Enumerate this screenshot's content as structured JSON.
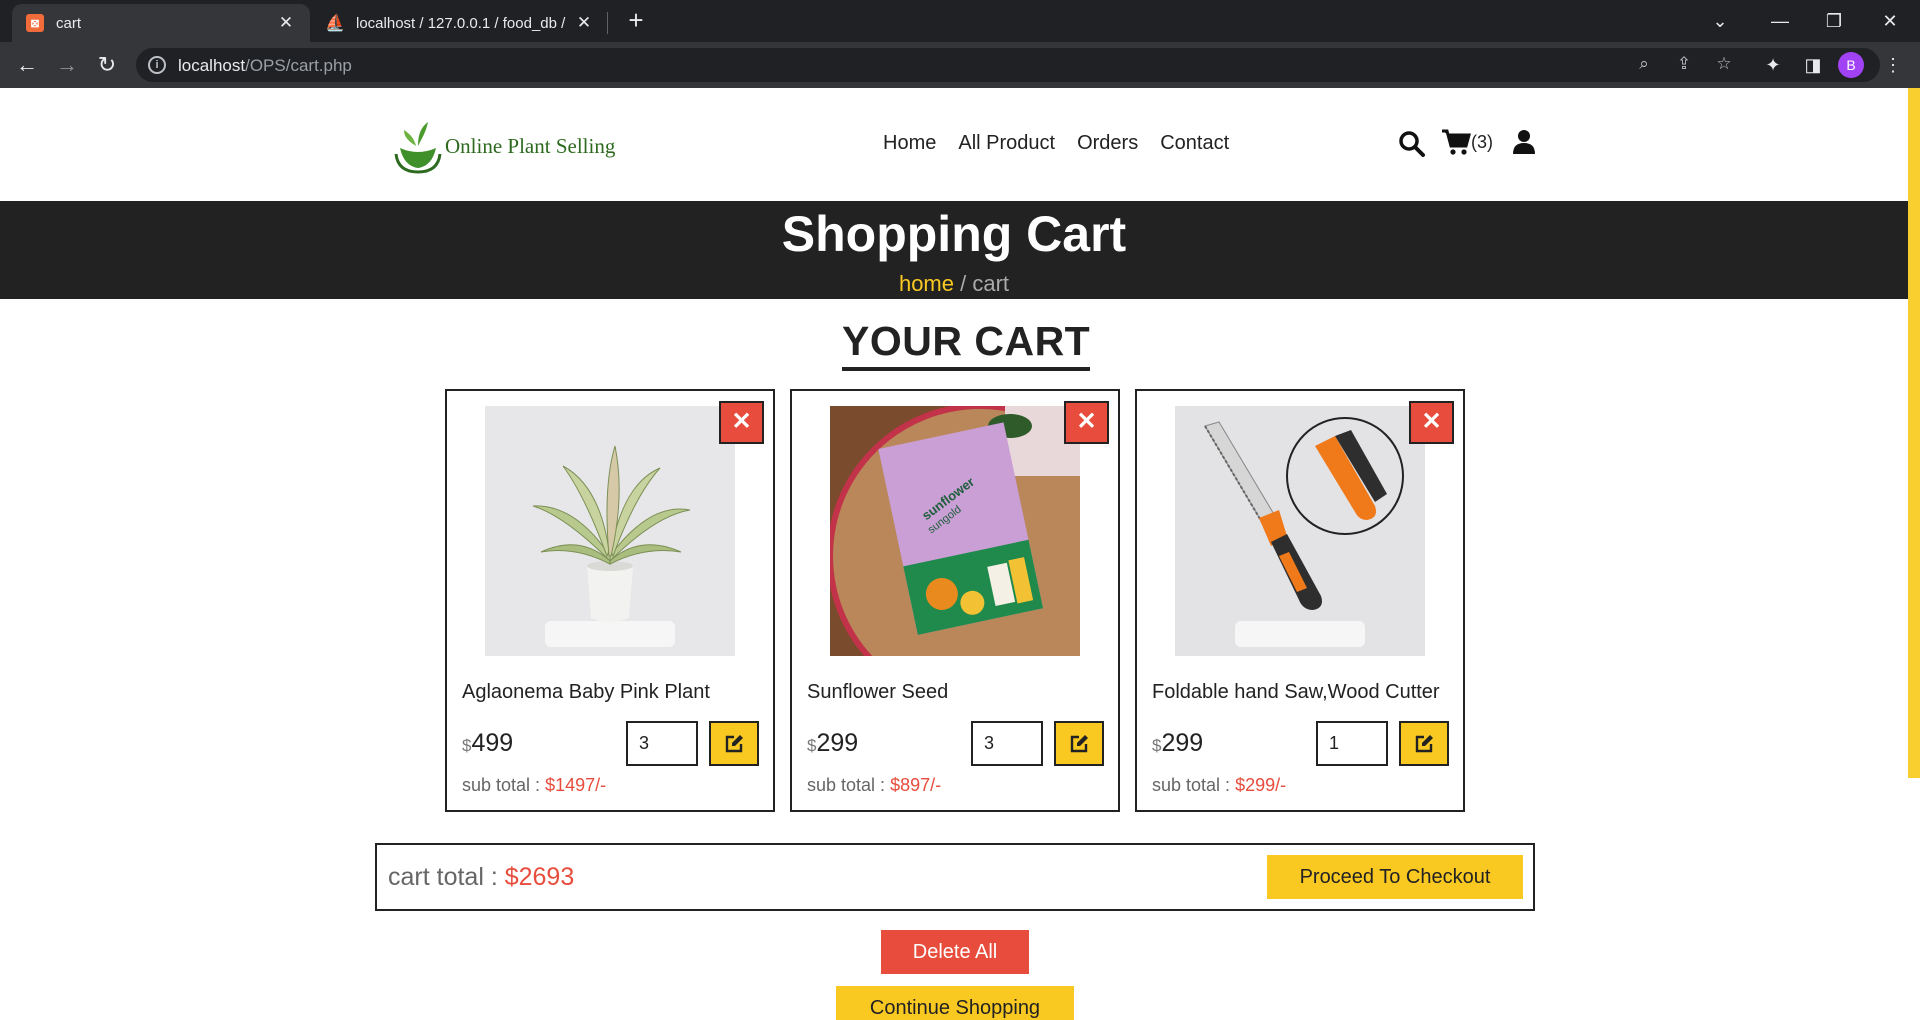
{
  "browser": {
    "tabs": [
      {
        "title": "cart",
        "active": true,
        "icon": "xampp-icon"
      },
      {
        "title": "localhost / 127.0.0.1 / food_db / ",
        "active": false,
        "icon": "phpmyadmin-icon"
      }
    ],
    "url_host": "localhost",
    "url_path": "/OPS/cart.php",
    "profile_initial": "B"
  },
  "site": {
    "logo_text": "Online Plant Selling",
    "nav": [
      "Home",
      "All Product",
      "Orders",
      "Contact"
    ],
    "cart_count": "(3)"
  },
  "banner": {
    "title": "Shopping Cart",
    "breadcrumb_home": "home",
    "breadcrumb_sep": " / ",
    "breadcrumb_current": "cart"
  },
  "cart": {
    "heading": "YOUR CART",
    "currency": "$",
    "items": [
      {
        "name": "Aglaonema Baby Pink Plant",
        "price": "499",
        "qty": "3",
        "subtotal_label": "sub total : ",
        "subtotal": "$1497/-"
      },
      {
        "name": "Sunflower Seed",
        "price": "299",
        "qty": "3",
        "subtotal_label": "sub total : ",
        "subtotal": "$897/-"
      },
      {
        "name": "Foldable hand Saw,Wood Cutter",
        "price": "299",
        "qty": "1",
        "subtotal_label": "sub total : ",
        "subtotal": "$299/-"
      }
    ],
    "total_label": "cart total : ",
    "total_value": "$2693",
    "checkout_label": "Proceed To Checkout",
    "delete_all_label": "Delete All",
    "continue_label": "Continue Shopping"
  },
  "colors": {
    "accent_yellow": "#f9c922",
    "danger_red": "#e74c3c",
    "banner_dark": "#222222"
  }
}
